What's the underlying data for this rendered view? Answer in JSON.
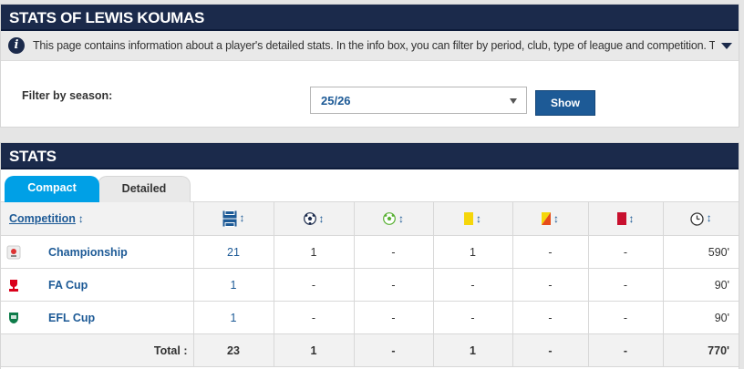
{
  "header": {
    "title": "STATS OF LEWIS KOUMAS"
  },
  "info": {
    "text": "This page contains information about a player's detailed stats. In the info box, you can filter by period, club, type of league and competition. T..."
  },
  "filter": {
    "label": "Filter by season:",
    "selected": "25/26",
    "button": "Show"
  },
  "stats": {
    "title": "STATS",
    "tabs": [
      {
        "label": "Compact",
        "active": true
      },
      {
        "label": "Detailed",
        "active": false
      }
    ],
    "columns": {
      "competition": "Competition",
      "icons": [
        "appearances-icon",
        "goals-icon",
        "assists-icon",
        "yellow-card-icon",
        "second-yellow-card-icon",
        "red-card-icon",
        "minutes-icon"
      ]
    },
    "rows": [
      {
        "competition": "Championship",
        "logo": "championship-logo-icon",
        "apps": "21",
        "goals": "1",
        "assists": "-",
        "yellow": "1",
        "second_yellow": "-",
        "red": "-",
        "minutes": "590'"
      },
      {
        "competition": "FA Cup",
        "logo": "fa-cup-logo-icon",
        "apps": "1",
        "goals": "-",
        "assists": "-",
        "yellow": "-",
        "second_yellow": "-",
        "red": "-",
        "minutes": "90'"
      },
      {
        "competition": "EFL Cup",
        "logo": "efl-cup-logo-icon",
        "apps": "1",
        "goals": "-",
        "assists": "-",
        "yellow": "-",
        "second_yellow": "-",
        "red": "-",
        "minutes": "90'"
      }
    ],
    "total": {
      "label": "Total :",
      "apps": "23",
      "goals": "1",
      "assists": "-",
      "yellow": "1",
      "second_yellow": "-",
      "red": "-",
      "minutes": "770'"
    }
  },
  "colors": {
    "header_bg": "#1b2a4b",
    "accent_blue": "#1d5a96",
    "tab_active": "#00a0e6",
    "yellow_card": "#f5d60a",
    "red_card": "#c8102e"
  }
}
